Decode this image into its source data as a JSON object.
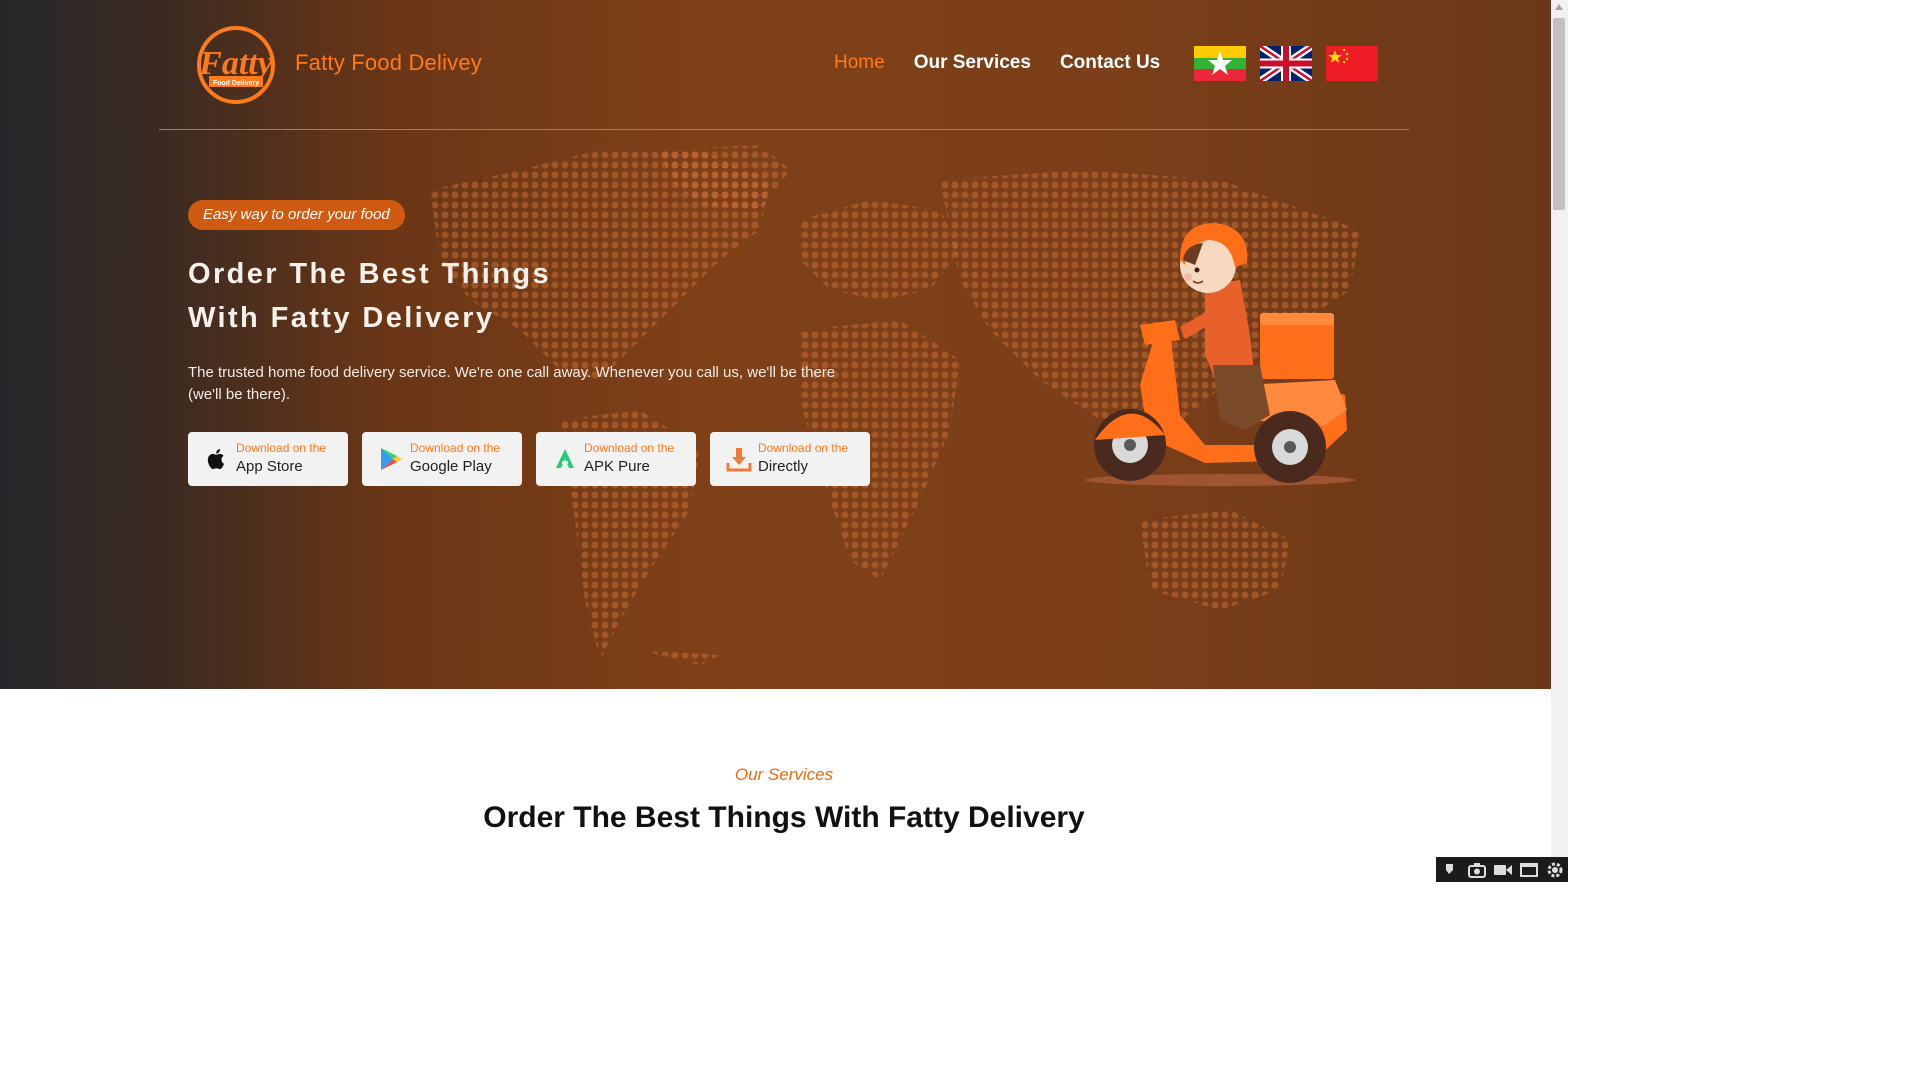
{
  "header": {
    "brand": "Fatty Food Delivey",
    "logo_text": "Fatty",
    "logo_sub": "Food Delivery",
    "nav": [
      {
        "label": "Home",
        "active": true
      },
      {
        "label": "Our Services",
        "active": false
      },
      {
        "label": "Contact Us",
        "active": false
      }
    ],
    "flags": [
      "myanmar-flag-icon",
      "uk-flag-icon",
      "china-flag-icon"
    ]
  },
  "hero": {
    "tagline": "Easy way to order your food",
    "headline_line1": "Order The Best Things",
    "headline_line2": "With Fatty Delivery",
    "description": "The trusted home food delivery service. We're one call away. Whenever you call us, we'll be there (we'll be there).",
    "buttons": [
      {
        "small": "Download on the",
        "big": "App Store",
        "icon": "apple-icon"
      },
      {
        "small": "Download on the",
        "big": "Google Play",
        "icon": "google-play-icon"
      },
      {
        "small": "Download on the",
        "big": "APK Pure",
        "icon": "apkpure-icon"
      },
      {
        "small": "Download on the",
        "big": "Directly",
        "icon": "download-icon"
      }
    ]
  },
  "services": {
    "label": "Our Services",
    "title": "Order The Best Things With Fatty Delivery"
  },
  "colors": {
    "accent": "#ff7a1a",
    "hero_bg": "#7f4018",
    "button_bg": "#f2f2f2"
  }
}
